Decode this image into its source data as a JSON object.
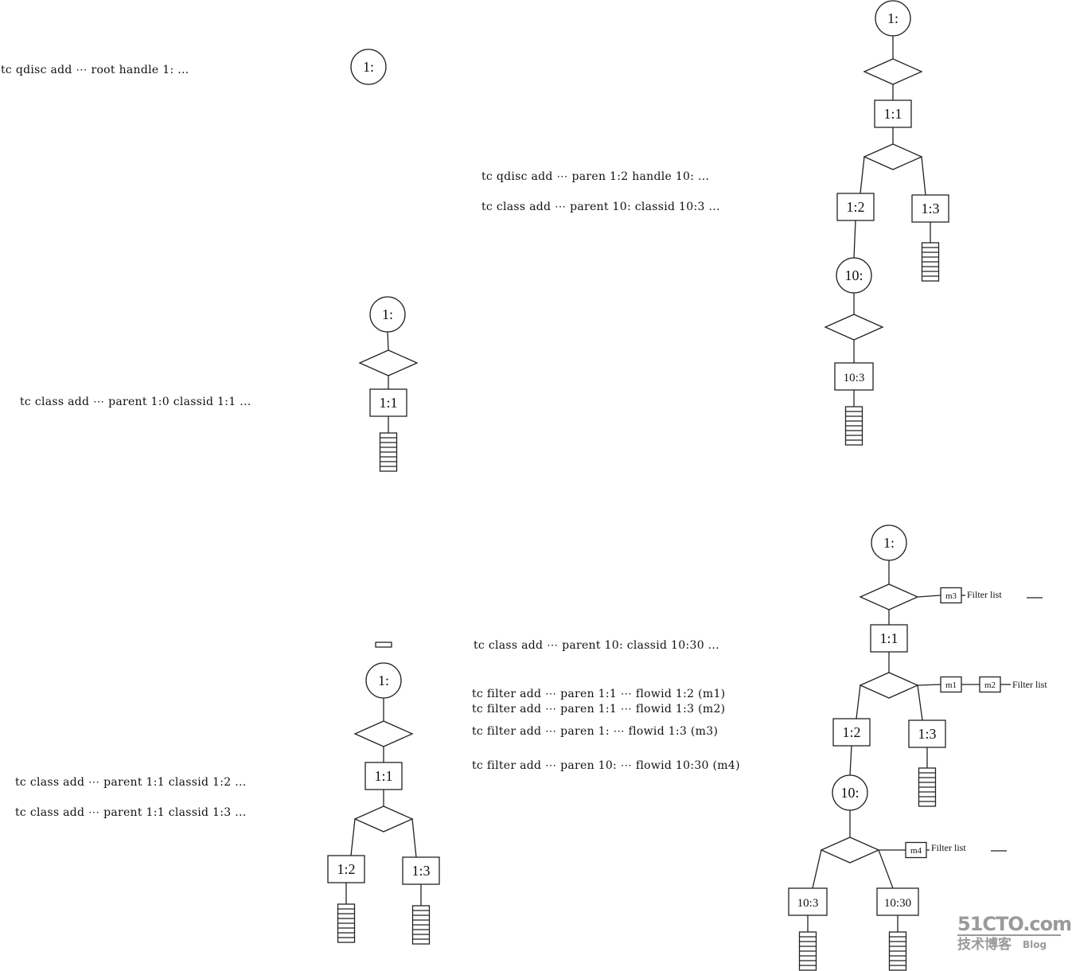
{
  "commands": {
    "qdisc_root": "tc qdisc add ⋯ root handle 1: ...",
    "class_1_1": "tc class add ⋯ parent 1:0 classid 1:1 ...",
    "qdisc_10": "tc qdisc add ⋯ paren 1:2 handle 10: ...",
    "class_10_3": "tc class add ⋯ parent 10: classid 10:3 ...",
    "class_1_2": "tc class add ⋯ parent 1:1 classid 1:2 ...",
    "class_1_3": "tc class add ⋯ parent 1:1 classid 1:3 ...",
    "class_10_30": "tc class add ⋯ parent 10: classid 10:30 ...",
    "filter_m1": "tc filter add ⋯ paren 1:1 ⋯ flowid 1:2 (m1)",
    "filter_m2": "tc filter add ⋯ paren 1:1 ⋯ flowid 1:3 (m2)",
    "filter_m3": "tc filter add ⋯ paren 1: ⋯ flowid 1:3 (m3)",
    "filter_m4": "tc filter add ⋯ paren 10: ⋯ flowid 10:30 (m4)"
  },
  "legend_shapes": {
    "circle": "qdisc",
    "diamond": "classifier",
    "box": "class",
    "stack": "queue"
  },
  "diagrams": [
    {
      "id": "step1",
      "nodes": [
        {
          "id": "q1",
          "type": "qdisc",
          "label": "1:"
        }
      ],
      "edges": []
    },
    {
      "id": "step2",
      "nodes": [
        {
          "id": "q1",
          "type": "qdisc",
          "label": "1:"
        },
        {
          "id": "d1",
          "type": "classifier",
          "label": ""
        },
        {
          "id": "c11",
          "type": "class",
          "label": "1:1"
        },
        {
          "id": "qu11",
          "type": "queue",
          "label": ""
        }
      ],
      "edges": [
        [
          "q1",
          "d1"
        ],
        [
          "d1",
          "c11"
        ],
        [
          "c11",
          "qu11"
        ]
      ]
    },
    {
      "id": "step3",
      "nodes": [
        {
          "id": "q1",
          "type": "qdisc",
          "label": "1:"
        },
        {
          "id": "d1",
          "type": "classifier",
          "label": ""
        },
        {
          "id": "c11",
          "type": "class",
          "label": "1:1"
        },
        {
          "id": "d2",
          "type": "classifier",
          "label": ""
        },
        {
          "id": "c12",
          "type": "class",
          "label": "1:2"
        },
        {
          "id": "c13",
          "type": "class",
          "label": "1:3"
        },
        {
          "id": "qu12",
          "type": "queue",
          "label": ""
        },
        {
          "id": "qu13",
          "type": "queue",
          "label": ""
        }
      ],
      "edges": [
        [
          "q1",
          "d1"
        ],
        [
          "d1",
          "c11"
        ],
        [
          "c11",
          "d2"
        ],
        [
          "d2",
          "c12"
        ],
        [
          "d2",
          "c13"
        ],
        [
          "c12",
          "qu12"
        ],
        [
          "c13",
          "qu13"
        ]
      ]
    },
    {
      "id": "step4",
      "nodes": [
        {
          "id": "q1",
          "type": "qdisc",
          "label": "1:"
        },
        {
          "id": "d1",
          "type": "classifier",
          "label": ""
        },
        {
          "id": "c11",
          "type": "class",
          "label": "1:1"
        },
        {
          "id": "d2",
          "type": "classifier",
          "label": ""
        },
        {
          "id": "c12",
          "type": "class",
          "label": "1:2"
        },
        {
          "id": "c13",
          "type": "class",
          "label": "1:3"
        },
        {
          "id": "qu13",
          "type": "queue",
          "label": ""
        },
        {
          "id": "q10",
          "type": "qdisc",
          "label": "10:"
        },
        {
          "id": "d3",
          "type": "classifier",
          "label": ""
        },
        {
          "id": "c103",
          "type": "class",
          "label": "10:3"
        },
        {
          "id": "qu103",
          "type": "queue",
          "label": ""
        }
      ],
      "edges": [
        [
          "q1",
          "d1"
        ],
        [
          "d1",
          "c11"
        ],
        [
          "c11",
          "d2"
        ],
        [
          "d2",
          "c12"
        ],
        [
          "d2",
          "c13"
        ],
        [
          "c13",
          "qu13"
        ],
        [
          "c12",
          "q10"
        ],
        [
          "q10",
          "d3"
        ],
        [
          "d3",
          "c103"
        ],
        [
          "c103",
          "qu103"
        ]
      ]
    },
    {
      "id": "step5",
      "nodes": [
        {
          "id": "q1",
          "type": "qdisc",
          "label": "1:"
        },
        {
          "id": "d1",
          "type": "classifier",
          "label": ""
        },
        {
          "id": "m3",
          "type": "filter",
          "label": "m3"
        },
        {
          "id": "c11",
          "type": "class",
          "label": "1:1"
        },
        {
          "id": "d2",
          "type": "classifier",
          "label": ""
        },
        {
          "id": "m1",
          "type": "filter",
          "label": "m1"
        },
        {
          "id": "m2",
          "type": "filter",
          "label": "m2"
        },
        {
          "id": "c12",
          "type": "class",
          "label": "1:2"
        },
        {
          "id": "c13",
          "type": "class",
          "label": "1:3"
        },
        {
          "id": "qu13",
          "type": "queue",
          "label": ""
        },
        {
          "id": "q10",
          "type": "qdisc",
          "label": "10:"
        },
        {
          "id": "d3",
          "type": "classifier",
          "label": ""
        },
        {
          "id": "m4",
          "type": "filter",
          "label": "m4"
        },
        {
          "id": "c103",
          "type": "class",
          "label": "10:3"
        },
        {
          "id": "c1030",
          "type": "class",
          "label": "10:30"
        },
        {
          "id": "qu103",
          "type": "queue",
          "label": ""
        },
        {
          "id": "qu1030",
          "type": "queue",
          "label": ""
        }
      ],
      "edges": [
        [
          "q1",
          "d1"
        ],
        [
          "d1",
          "m3"
        ],
        [
          "d1",
          "c11"
        ],
        [
          "c11",
          "d2"
        ],
        [
          "d2",
          "m1"
        ],
        [
          "m1",
          "m2"
        ],
        [
          "d2",
          "c12"
        ],
        [
          "d2",
          "c13"
        ],
        [
          "c13",
          "qu13"
        ],
        [
          "c12",
          "q10"
        ],
        [
          "q10",
          "d3"
        ],
        [
          "d3",
          "m4"
        ],
        [
          "d3",
          "c103"
        ],
        [
          "d3",
          "c1030"
        ],
        [
          "c103",
          "qu103"
        ],
        [
          "c1030",
          "qu1030"
        ]
      ],
      "filter_list_label": "Filter list"
    }
  ],
  "watermark": {
    "brand": "51CTO.com",
    "subtitle": "技术博客",
    "blog": "Blog"
  }
}
